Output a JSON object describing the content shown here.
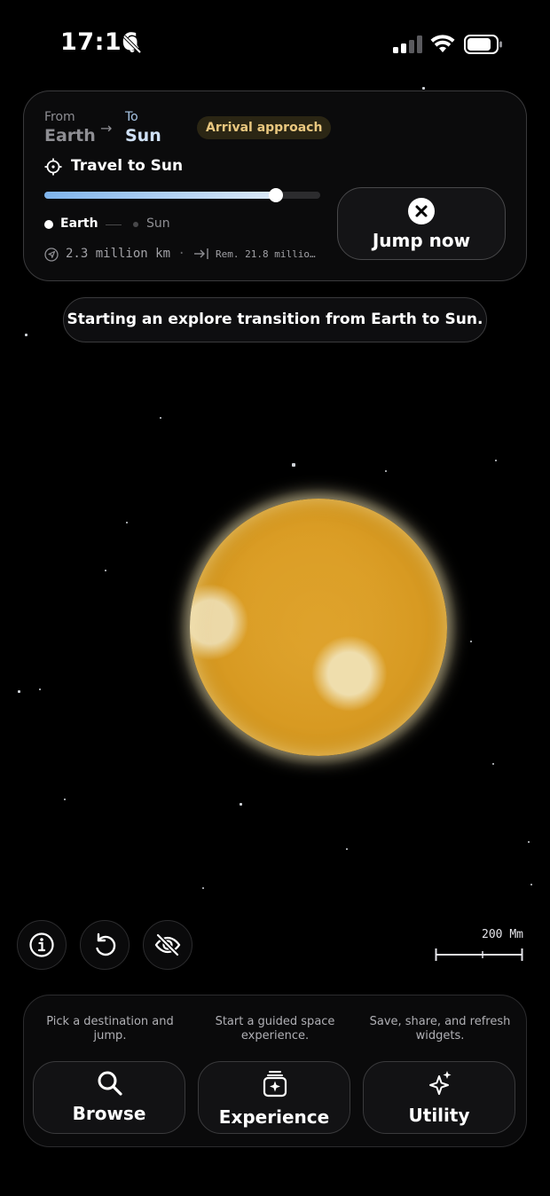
{
  "status_bar": {
    "time": "17:16"
  },
  "trip": {
    "from_label": "From",
    "from_value": "Earth",
    "to_label": "To",
    "to_value": "Sun",
    "badge": "Arrival approach",
    "title": "Travel to Sun",
    "progress": 0.84,
    "legend_start": "Earth",
    "legend_end": "Sun",
    "distance": "2.3 million km",
    "separator": "·",
    "remaining": "Rem. 21.8 millio…",
    "jump_label": "Jump now"
  },
  "toast": "Starting an explore transition from Earth to Sun.",
  "scale": {
    "label": "200 Mm"
  },
  "dock": {
    "browse": {
      "hint": "Pick a destination and jump.",
      "label": "Browse",
      "icon": "search-icon"
    },
    "experience": {
      "hint": "Start a guided space experience.",
      "label": "Experience",
      "icon": "sparkle-card-icon"
    },
    "utility": {
      "hint": "Save, share, and refresh widgets.",
      "label": "Utility",
      "icon": "sparkles-icon"
    }
  },
  "colors": {
    "accent": "#7fb4ec",
    "badge_text": "#e9c77f",
    "sun": "#d89a22"
  }
}
